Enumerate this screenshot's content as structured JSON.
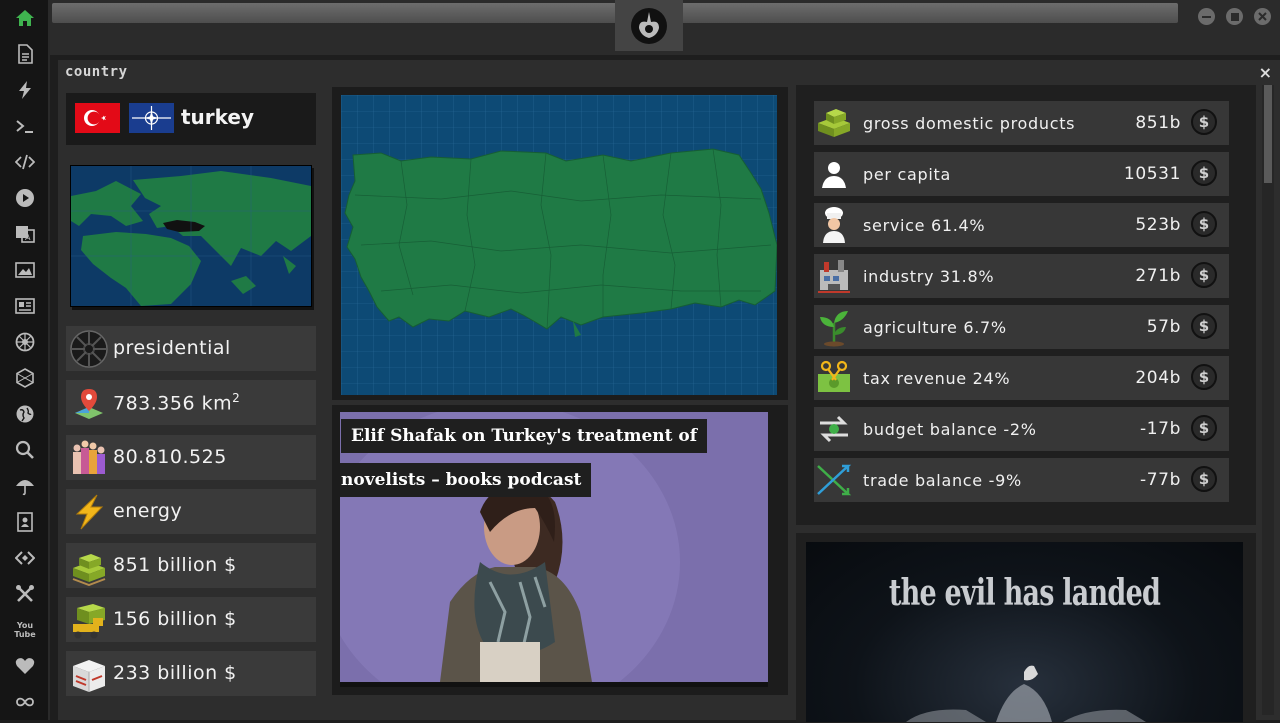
{
  "sidebar": {
    "icons": [
      "home-icon",
      "document-icon",
      "lightning-icon",
      "terminal-icon",
      "code-icon",
      "play-icon",
      "translate-icon",
      "image-icon",
      "newspaper-icon",
      "empire-icon",
      "hexagon-icon",
      "globe-icon",
      "search-icon",
      "umbrella-icon",
      "contact-card-icon",
      "diamond-code-icon",
      "tools-icon",
      "youtube-icon",
      "heart-icon",
      "infinity-icon"
    ],
    "youtube_text": "You Tube"
  },
  "window": {
    "title": "country",
    "close": "×"
  },
  "country": {
    "name": "turkey",
    "flags": [
      "turkey-flag",
      "nato-flag"
    ],
    "stats": [
      {
        "icon": "empire-icon",
        "text": "presidential"
      },
      {
        "icon": "map-pin-icon",
        "text": "783.356 km",
        "sup": "2"
      },
      {
        "icon": "population-icon",
        "text": "80.810.525"
      },
      {
        "icon": "lightning-icon",
        "text": "energy"
      },
      {
        "icon": "money-stack-icon",
        "text": "851 billion $"
      },
      {
        "icon": "forklift-money-icon",
        "text": "156 billion $"
      },
      {
        "icon": "boxes-icon",
        "text": "233 billion $"
      }
    ]
  },
  "news": {
    "line1": "Elif Shafak on Turkey's treatment of",
    "line2": "novelists – books podcast"
  },
  "economy": {
    "currency_symbol": "$",
    "rows": [
      {
        "icon": "money-stack-icon",
        "label": "gross domestic products",
        "value": "851b"
      },
      {
        "icon": "person-icon",
        "label": "per capita",
        "value": "10531"
      },
      {
        "icon": "chef-icon",
        "label": "service 61.4%",
        "value": "523b"
      },
      {
        "icon": "factory-icon",
        "label": "industry 31.8%",
        "value": "271b"
      },
      {
        "icon": "plant-icon",
        "label": "agriculture 6.7%",
        "value": "57b"
      },
      {
        "icon": "tax-icon",
        "label": "tax revenue 24%",
        "value": "204b"
      },
      {
        "icon": "balance-arrows-icon",
        "label": "budget balance -2%",
        "value": "-17b"
      },
      {
        "icon": "trade-arrows-icon",
        "label": "trade balance -9%",
        "value": "-77b"
      }
    ]
  },
  "poster": {
    "title": "the evil has landed"
  }
}
